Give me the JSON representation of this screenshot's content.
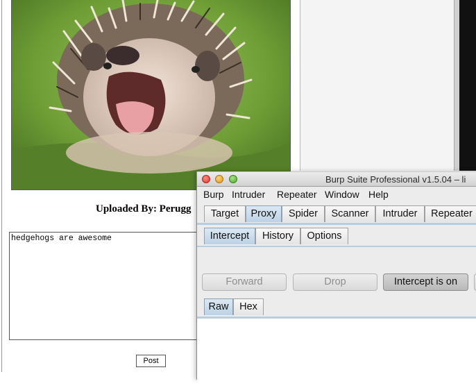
{
  "webpage": {
    "uploaded_by": "Uploaded By: Perugg",
    "comment_text": "hedgehogs are awesome",
    "post_button": "Post",
    "photo_icon": "hedgehog-photo"
  },
  "burp": {
    "window_title": "Burp Suite Professional v1.5.04 – li",
    "menu": [
      "Burp",
      "Intruder",
      "Repeater",
      "Window",
      "Help"
    ],
    "main_tabs": [
      "Target",
      "Proxy",
      "Spider",
      "Scanner",
      "Intruder",
      "Repeater"
    ],
    "main_tab_selected": "Proxy",
    "proxy_tabs": [
      "Intercept",
      "History",
      "Options"
    ],
    "proxy_tab_selected": "Intercept",
    "buttons": {
      "forward": "Forward",
      "drop": "Drop",
      "intercept": "Intercept is on"
    },
    "message_tabs": [
      "Raw",
      "Hex"
    ],
    "message_tab_selected": "Raw"
  },
  "colors": {
    "tab_selected": "#bcd2e6",
    "tab_underline": "#b7cde0",
    "close": "#d8382c",
    "minimize": "#dd9a20",
    "maximize": "#52a83a"
  }
}
